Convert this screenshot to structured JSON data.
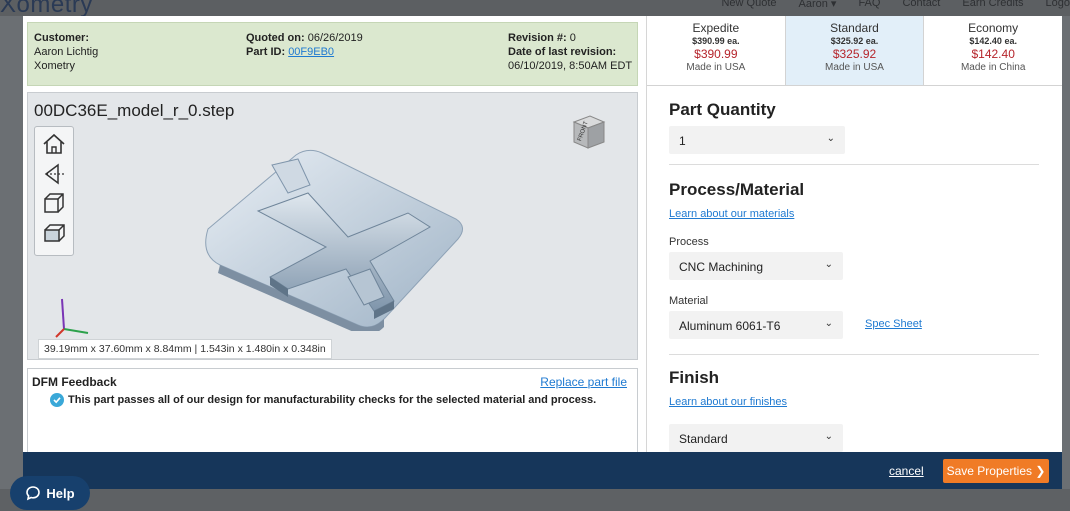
{
  "header": {
    "logo": "Xometry",
    "nav": [
      "New Quote",
      "Aaron ▾",
      "FAQ",
      "Contact",
      "Earn Credits",
      "Logo"
    ]
  },
  "info": {
    "customer_label": "Customer:",
    "customer_name": "Aaron Lichtig",
    "customer_company": "Xometry",
    "quoted_label": "Quoted on:",
    "quoted_value": "06/26/2019",
    "partid_label": "Part ID:",
    "partid_value": "00F9EB0",
    "revision_label": "Revision #:",
    "revision_value": "0",
    "lastrev_label": "Date of last revision:",
    "lastrev_value": "06/10/2019, 8:50AM EDT"
  },
  "viewer": {
    "filename": "00DC36E_model_r_0.step",
    "dimensions": "39.19mm x 37.60mm x 8.84mm | 1.543in x 1.480in x 0.348in",
    "cube_label": "FRONT",
    "tools": [
      "home-icon",
      "perspective-icon",
      "wireframe-cube-icon",
      "shaded-cube-icon"
    ]
  },
  "dfm": {
    "title": "DFM Feedback",
    "replace_link": "Replace part file",
    "message": "This part passes all of our design for manufacturability checks for the selected material and process."
  },
  "pricing": [
    {
      "name": "Expedite",
      "each": "$390.99 ea.",
      "total": "$390.99",
      "origin": "Made in USA",
      "selected": false
    },
    {
      "name": "Standard",
      "each": "$325.92 ea.",
      "total": "$325.92",
      "origin": "Made in USA",
      "selected": true
    },
    {
      "name": "Economy",
      "each": "$142.40 ea.",
      "total": "$142.40",
      "origin": "Made in China",
      "selected": false
    }
  ],
  "form": {
    "quantity_title": "Part Quantity",
    "quantity_value": "1",
    "process_title": "Process/Material",
    "materials_link": "Learn about our materials",
    "process_label": "Process",
    "process_value": "CNC Machining",
    "material_label": "Material",
    "material_value": "Aluminum 6061-T6",
    "spec_sheet_link": "Spec Sheet",
    "finish_title": "Finish",
    "finishes_link": "Learn about our finishes",
    "finish_value": "Standard",
    "dropdown_glyph": "⌄"
  },
  "footer": {
    "cancel": "cancel",
    "save": "Save Properties ❯"
  },
  "help": {
    "label": "Help"
  },
  "colors": {
    "accent_orange": "#f07b26",
    "footer_navy": "#16365a",
    "price_red": "#b5242b",
    "link_blue": "#1f7ad1",
    "info_green": "#dbe8cf",
    "selected_tier": "#e2eff9"
  }
}
